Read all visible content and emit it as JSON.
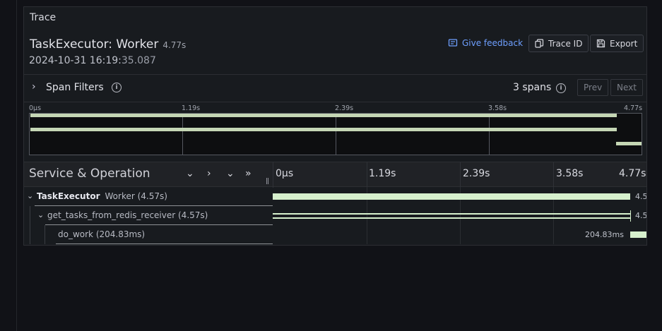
{
  "panel": {
    "title": "Trace"
  },
  "trace": {
    "name": "TaskExecutor: Worker",
    "duration": "4.77s",
    "date_main": "2024-10-31 16:19:",
    "date_rest": "35.087"
  },
  "actions": {
    "feedback_label": "Give feedback",
    "trace_id_label": "Trace ID",
    "export_label": "Export"
  },
  "filters": {
    "chevron": "›",
    "label": "Span Filters",
    "span_count": "3 spans",
    "prev_label": "Prev",
    "next_label": "Next"
  },
  "minimap": {
    "ticks": [
      "0µs",
      "1.19s",
      "2.39s",
      "3.58s",
      "4.77s"
    ]
  },
  "timeline_header": {
    "title": "Service & Operation",
    "ticks": [
      "0µs",
      "1.19s",
      "2.39s",
      "3.58s",
      "4.77s"
    ]
  },
  "spans": [
    {
      "service": "TaskExecutor",
      "operation": "Worker (4.57s)",
      "duration_label": "4.5",
      "start_s": 0,
      "duration_s": 4.57
    },
    {
      "service": "",
      "operation": "get_tasks_from_redis_receiver (4.57s)",
      "duration_label": "4.5",
      "start_s": 0,
      "duration_s": 4.57
    },
    {
      "service": "",
      "operation": "do_work (204.83ms)",
      "duration_label": "204.83ms",
      "start_s": 4.56,
      "duration_s": 0.20483
    }
  ],
  "icons": {
    "feedback": "comment-icon",
    "trace_id": "copy-icon",
    "export": "save-icon",
    "info": "info-circle-icon"
  },
  "colors": {
    "span_bar": "#d6f0cd",
    "minimap_bar": "#c5d7b5",
    "link": "#6e9fff"
  }
}
